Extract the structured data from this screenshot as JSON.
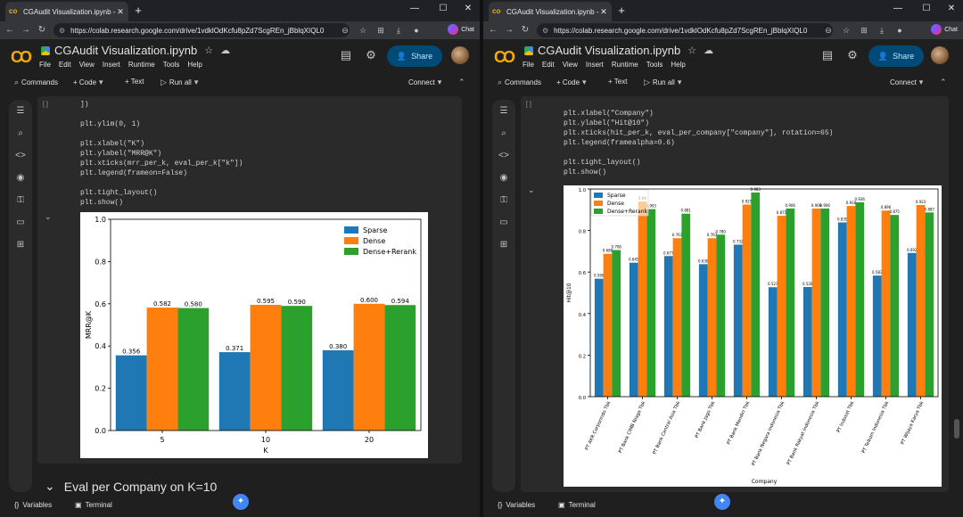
{
  "window_controls": {
    "minimize": "—",
    "maximize": "☐",
    "close": "✕"
  },
  "left": {
    "tab_title": "CGAudit Visualization.ipynb - Cola",
    "url": "https://colab.research.google.com/drive/1vdklOdKcfu8pZd7ScgREn_jBblqXIQL0",
    "chat_label": "Chat",
    "notebook_title": "CGAudit Visualization.ipynb",
    "menu": [
      "File",
      "Edit",
      "View",
      "Insert",
      "Runtime",
      "Tools",
      "Help"
    ],
    "share_label": "Share",
    "toolbar": {
      "commands": "Commands",
      "code": "+ Code",
      "text": "+ Text",
      "run_all": "Run all",
      "connect": "Connect"
    },
    "run_bracket": "[ ]",
    "code_lines": [
      "])",
      "",
      "plt.ylim(0, 1)",
      "",
      "plt.xlabel(\"K\")",
      "plt.ylabel(\"MRR@K\")",
      "plt.xticks(mrr_per_k, eval_per_k[\"k\"])",
      "plt.legend(frameon=False)",
      "",
      "plt.tight_layout()",
      "plt.show()"
    ],
    "section_heading": "Eval per Company on K=10",
    "status": {
      "variables": "Variables",
      "terminal": "Terminal"
    }
  },
  "right": {
    "tab_title": "CGAudit Visualization.ipynb - Cola",
    "url": "https://colab.research.google.com/drive/1vdklOdKcfu8pZd7ScgREn_jBblqXIQL0",
    "chat_label": "Chat",
    "notebook_title": "CGAudit Visualization.ipynb",
    "menu": [
      "File",
      "Edit",
      "View",
      "Insert",
      "Runtime",
      "Tools",
      "Help"
    ],
    "share_label": "Share",
    "toolbar": {
      "commands": "Commands",
      "code": "+ Code",
      "text": "+ Text",
      "run_all": "Run all",
      "connect": "Connect"
    },
    "run_bracket": "[ ]",
    "code_lines": [
      "plt.xlabel(\"Company\")",
      "plt.ylabel(\"Hit@10\")",
      "plt.xticks(hit_per_k, eval_per_company[\"company\"], rotation=65)",
      "plt.legend(framealpha=0.6)",
      "",
      "plt.tight_layout()",
      "plt.show()"
    ],
    "status": {
      "variables": "Variables",
      "terminal": "Terminal"
    }
  },
  "icons": {
    "sidebar": [
      "toc-icon",
      "find-icon",
      "code-snippets-icon",
      "secrets-icon",
      "key-icon",
      "files-icon",
      "table-icon"
    ],
    "colors": {
      "sparse": "#1f77b4",
      "dense": "#ff7f0e",
      "rerank": "#2ca02c",
      "accent": "#f9ab00",
      "share_bg": "#004a77"
    }
  },
  "chart_data": [
    {
      "type": "bar",
      "title": "",
      "xlabel": "K",
      "ylabel": "MRR@K",
      "ylim": [
        0,
        1.0
      ],
      "yticks": [
        "0.0",
        "0.2",
        "0.4",
        "0.6",
        "0.8",
        "1.0"
      ],
      "categories": [
        "5",
        "10",
        "20"
      ],
      "legend_position": "top-right",
      "series": [
        {
          "name": "Sparse",
          "values": [
            0.356,
            0.371,
            0.38
          ],
          "labels": [
            "0.356",
            "0.371",
            "0.380"
          ]
        },
        {
          "name": "Dense",
          "values": [
            0.582,
            0.595,
            0.6
          ],
          "labels": [
            "0.582",
            "0.595",
            "0.600"
          ]
        },
        {
          "name": "Dense+Rerank",
          "values": [
            0.58,
            0.59,
            0.594
          ],
          "labels": [
            "0.580",
            "0.590",
            "0.594"
          ]
        }
      ]
    },
    {
      "type": "bar",
      "title": "",
      "xlabel": "Company",
      "ylabel": "Hit@10",
      "ylim": [
        0,
        1.0
      ],
      "yticks": [
        "0.0",
        "0.2",
        "0.4",
        "0.6",
        "0.8",
        "1.0"
      ],
      "legend_position": "top-left",
      "categories": [
        "PT AKR Corporindo Tbk",
        "PT Bank CIMB Niaga Tbk",
        "PT Bank Central Asia Tbk",
        "PT Bank Jago Tbk",
        "PT Bank Mandiri Tbk",
        "PT Bank Negara Indonesia Tbk",
        "PT Bank Rakyat Indonesia Tbk",
        "PT Indosat Tbk",
        "PT Telkom Indonesia Tbk",
        "PT Wijaya Karya Tbk"
      ],
      "series": [
        {
          "name": "Sparse",
          "values": [
            0.568,
            0.645,
            0.677,
            0.638,
            0.732,
            0.527,
            0.528,
            0.839,
            0.583,
            0.692
          ],
          "labels": [
            "0.568",
            "0.645",
            "0.677",
            "0.638",
            "0.732",
            "0.527",
            "0.528",
            "0.839",
            "0.583",
            "0.692"
          ]
        },
        {
          "name": "Dense",
          "values": [
            0.688,
            0.94,
            0.763,
            0.763,
            0.925,
            0.871,
            0.906,
            0.918,
            0.896,
            0.923
          ],
          "labels": [
            "0.688",
            "0.94",
            "0.763",
            "0.763",
            "0.925",
            "0.871",
            "0.906",
            "0.918",
            "0.896",
            "0.923"
          ]
        },
        {
          "name": "Dense+Rerank",
          "values": [
            0.706,
            0.903,
            0.881,
            0.78,
            0.983,
            0.906,
            0.906,
            0.936,
            0.875,
            0.887
          ],
          "labels": [
            "0.706",
            "0.903",
            "0.881",
            "0.780",
            "0.983",
            "0.906",
            "0.906",
            "0.936",
            "0.875",
            "0.887"
          ]
        }
      ]
    }
  ]
}
